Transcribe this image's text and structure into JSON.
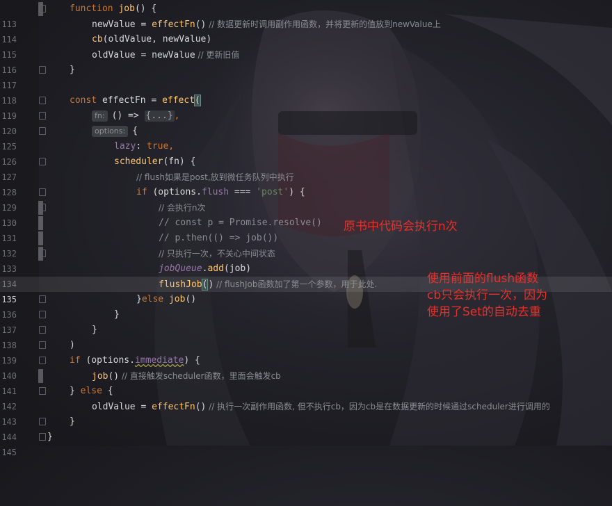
{
  "editor": {
    "hints": {
      "fn": "fn:",
      "options": "options:"
    },
    "collapsed_text": "{...}",
    "lines": {
      "l113": {
        "num": "113",
        "t1": "function",
        "t2": "job",
        "t3": "() {"
      },
      "l114": {
        "num": "114",
        "t1": "newValue",
        "t2": " = ",
        "t3": "effectFn",
        "t4": "()",
        "t5": " // 数据更新时调用副作用函数，并将更新的值放到newValue上"
      },
      "l115": {
        "num": "115",
        "t1": "cb",
        "t2": "(oldValue, newValue)"
      },
      "l116": {
        "num": "116",
        "t1": "oldValue = newValue",
        "t2": " // 更新旧值"
      },
      "l117": {
        "num": "117",
        "t1": "}"
      },
      "l118": {
        "num": "118"
      },
      "l119": {
        "num": "119",
        "t1": "const",
        "t2": " effectFn = ",
        "t3": "effect",
        "t4": "("
      },
      "l120": {
        "num": "120",
        "t1": "() => ",
        "t2": ","
      },
      "l125": {
        "num": "125",
        "t1": "{"
      },
      "l126": {
        "num": "126",
        "t1": "lazy",
        "t2": ": ",
        "t3": "true",
        "t4": ","
      },
      "l127": {
        "num": "127",
        "t1": "scheduler",
        "t2": "(fn) {"
      },
      "l128": {
        "num": "128",
        "t1": "// flush如果是post,放到微任务队列中执行"
      },
      "l129": {
        "num": "129",
        "t1": "if",
        "t2": " (options.",
        "t3": "flush",
        "t4": " === ",
        "t5": "'post'",
        "t6": ") {"
      },
      "l130": {
        "num": "130",
        "t1": "// 会执行n次"
      },
      "l131": {
        "num": "131",
        "t1": "// const p = Promise.resolve()"
      },
      "l132": {
        "num": "132",
        "t1": "// p.then(() => job())"
      },
      "l133": {
        "num": "133",
        "t1": "// 只执行一次，不关心中间状态"
      },
      "l134": {
        "num": "134",
        "t1": "jobQueue",
        "t2": ".",
        "t3": "add",
        "t4": "(job)"
      },
      "l135": {
        "num": "135",
        "t1": "flushJob",
        "t2": "(",
        "t3": ")",
        "t4": " // flushJob函数加了第一个参数，用于此处."
      },
      "l136": {
        "num": "136",
        "t1": "}",
        "t2": "else",
        "t3": " ",
        "t4": "job",
        "t5": "()"
      },
      "l137": {
        "num": "137",
        "t1": "}"
      },
      "l138": {
        "num": "138",
        "t1": "}"
      },
      "l139": {
        "num": "139",
        "t1": ")"
      },
      "l140": {
        "num": "140",
        "t1": "if",
        "t2": " (options.",
        "t3": "immediate",
        "t4": ") {"
      },
      "l141": {
        "num": "141",
        "t1": "job",
        "t2": "()",
        "t3": " // 直接触发scheduler函数，里面会触发cb"
      },
      "l142": {
        "num": "142",
        "t1": "} ",
        "t2": "else",
        "t3": " {"
      },
      "l143": {
        "num": "143",
        "t1": "oldValue = ",
        "t2": "effectFn",
        "t3": "()",
        "t4": " // 执行一次副作用函数, 但不执行cb，因为cb是在数据更新的时候通过scheduler进行调用的"
      },
      "l144": {
        "num": "144",
        "t1": "}"
      },
      "l145": {
        "num": "145",
        "t1": "}"
      }
    }
  },
  "annotations": {
    "note1": "原书中代码会执行n次",
    "note2_line1": "使用前面的flush函数",
    "note2_line2": "cb只会执行一次，因为",
    "note2_line3": "使用了Set的自动去重"
  },
  "colors": {
    "keyword": "#cc7832",
    "function": "#ffc66d",
    "property": "#9876aa",
    "string": "#6a8759",
    "comment": "#8a8d93",
    "annotation": "#e8302a"
  }
}
